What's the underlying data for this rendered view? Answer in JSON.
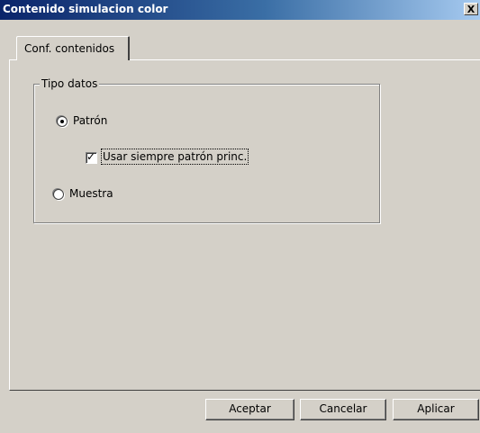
{
  "window": {
    "title": "Contenido simulacion color",
    "close_label": "X"
  },
  "tabs": [
    {
      "label": "Conf. contenidos",
      "selected": true
    }
  ],
  "group": {
    "legend": "Tipo datos",
    "options": [
      {
        "label": "Patrón",
        "selected": true
      },
      {
        "label": "Muestra",
        "selected": false
      }
    ],
    "checkbox": {
      "label": "Usar siempre patrón princ.",
      "checked": true
    }
  },
  "buttons": {
    "ok": "Aceptar",
    "cancel": "Cancelar",
    "apply": "Aplicar"
  },
  "colors": {
    "title_bar_start": "#0a246a",
    "title_bar_end": "#a6caf0",
    "face": "#d4d0c8"
  }
}
